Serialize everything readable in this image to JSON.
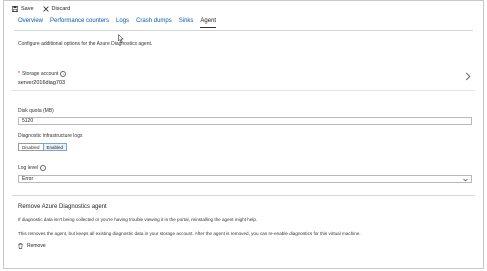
{
  "toolbar": {
    "save_label": "Save",
    "discard_label": "Discard"
  },
  "tabs": [
    {
      "label": "Overview"
    },
    {
      "label": "Performance counters"
    },
    {
      "label": "Logs"
    },
    {
      "label": "Crash dumps"
    },
    {
      "label": "Sinks"
    },
    {
      "label": "Agent"
    }
  ],
  "active_tab": "Agent",
  "intro": "Configure additional options for the Azure Diagnostics agent.",
  "storage": {
    "label": "Storage account",
    "value": "server2016diag703"
  },
  "disk_quota": {
    "label": "Disk quota (MB)",
    "value": "5120"
  },
  "infra_logs": {
    "label": "Diagnostic infrastructure logs",
    "options": [
      "Disabled",
      "Enabled"
    ],
    "selected": "Enabled"
  },
  "log_level": {
    "label": "Log level",
    "value": "Error"
  },
  "remove": {
    "title": "Remove Azure Diagnostics agent",
    "text1": "If diagnostic data isn't being collected or you're having trouble viewing it in the portal, reinstalling the agent might help.",
    "text2": "This removes the agent, but keeps all existing diagnostic data in your storage account. After the agent is removed, you can re-enable diagnostics for this virtual machine.",
    "button_label": "Remove"
  },
  "colors": {
    "link": "#0b5aa6",
    "required": "#cc0000",
    "toggle_selected_bg": "#e8f2fb"
  }
}
